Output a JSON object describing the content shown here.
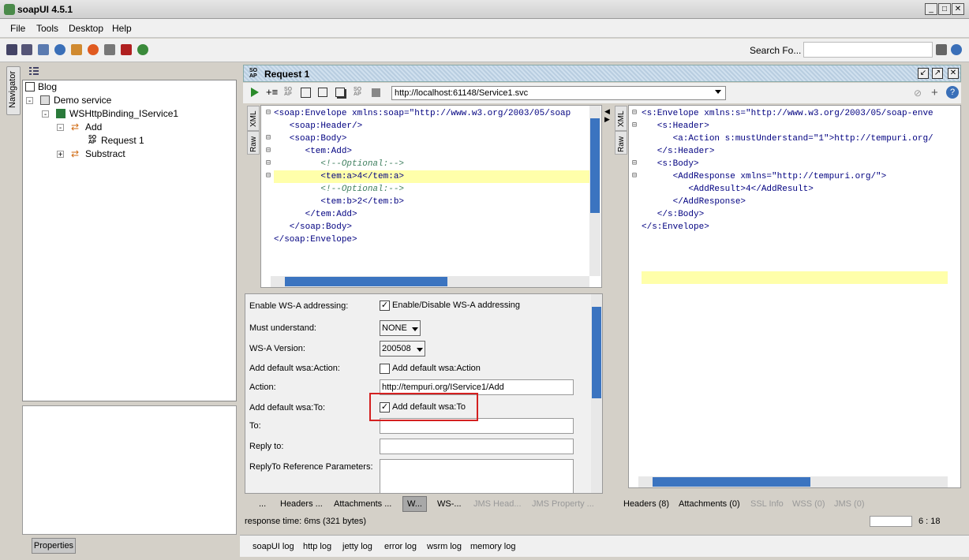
{
  "app": {
    "title": "soapUI 4.5.1"
  },
  "menu": [
    "File",
    "Tools",
    "Desktop",
    "Help"
  ],
  "toolbar": {
    "search_label": "Search Fo..."
  },
  "navigator": {
    "tab_label": "Navigator"
  },
  "tree": {
    "items": [
      {
        "label": "Blog"
      },
      {
        "label": "Demo service"
      },
      {
        "label": "WSHttpBinding_IService1"
      },
      {
        "label": "Add"
      },
      {
        "label": "Request 1"
      },
      {
        "label": "Substract"
      }
    ]
  },
  "properties_button": "Properties",
  "request": {
    "title": "Request 1",
    "url": "http://localhost:61148/Service1.svc",
    "left_tabs": [
      "XML",
      "Raw"
    ],
    "request_code": [
      "<soap:Envelope xmlns:soap=\"http://www.w3.org/2003/05/soap",
      "   <soap:Header/>",
      "   <soap:Body>",
      "      <tem:Add>",
      "         <!--Optional:-->",
      "         <tem:a>4</tem:a>",
      "         <!--Optional:-->",
      "         <tem:b>2</tem:b>",
      "      </tem:Add>",
      "   </soap:Body>",
      "</soap:Envelope>"
    ],
    "response_code": [
      "<s:Envelope xmlns:s=\"http://www.w3.org/2003/05/soap-enve",
      "   <s:Header>",
      "      <a:Action s:mustUnderstand=\"1\">http://tempuri.org/",
      "   </s:Header>",
      "   <s:Body>",
      "      <AddResponse xmlns=\"http://tempuri.org/\">",
      "         <AddResult>4</AddResult>",
      "      </AddResponse>",
      "   </s:Body>",
      "</s:Envelope>"
    ]
  },
  "wsa": {
    "enable_label": "Enable WS-A addressing:",
    "enable_cb": "Enable/Disable WS-A addressing",
    "must_label": "Must understand:",
    "must_value": "NONE",
    "version_label": "WS-A Version:",
    "version_value": "200508",
    "action_default_label": "Add default wsa:Action:",
    "action_default_cb": "Add default wsa:Action",
    "action_label": "Action:",
    "action_value": "http://tempuri.org/IService1/Add",
    "to_default_label": "Add default wsa:To:",
    "to_default_cb": "Add default wsa:To",
    "to_label": "To:",
    "reply_label": "Reply to:",
    "replyref_label": "ReplyTo Reference Parameters:"
  },
  "request_tabs": [
    "...",
    "Headers ...",
    "Attachments ...",
    "W...",
    "WS-...",
    "JMS Head...",
    "JMS Property ..."
  ],
  "response_tabs": [
    "Headers (8)",
    "Attachments (0)",
    "SSL Info",
    "WSS (0)",
    "JMS (0)"
  ],
  "status": {
    "response_time": "response time: 6ms (321 bytes)",
    "position": "6 : 18"
  },
  "logs": [
    "soapUI log",
    "http log",
    "jetty log",
    "error log",
    "wsrm log",
    "memory log"
  ],
  "colors": {
    "accent_red": "#d42020",
    "scroll_thumb": "#3b74c0",
    "highlight": "#ffffaa"
  }
}
